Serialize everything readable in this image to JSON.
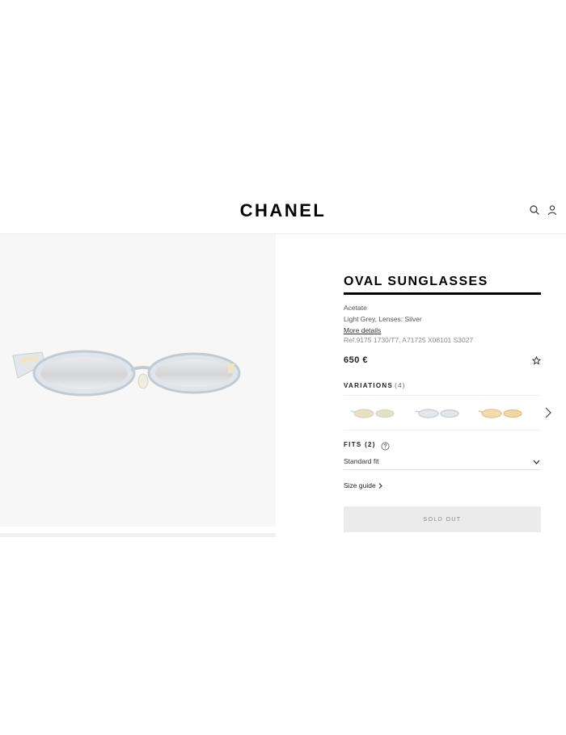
{
  "header": {
    "brand": "CHANEL",
    "icons": [
      "search-icon",
      "account-icon"
    ]
  },
  "product": {
    "title": "OVAL SUNGLASSES",
    "material": "Acetate",
    "color": "Light Grey, Lenses: Silver",
    "more_details": "More details",
    "ref": "Ref.9175 1730/T7, A71725 X08101 S3027",
    "price": "650 €",
    "wishlist_icon": "star-icon"
  },
  "variations": {
    "label": "VARIATIONS",
    "count": "(4)",
    "items": [
      {
        "name": "grey-gold",
        "frame": "#d9d0b0",
        "lens": "#e3dba7"
      },
      {
        "name": "light-grey",
        "frame": "#d6dbe0",
        "lens": "#e6e8ea"
      },
      {
        "name": "amber",
        "frame": "#e8c88e",
        "lens": "#f0d8a8"
      }
    ]
  },
  "fits": {
    "label": "FITS",
    "count": "(2)",
    "selected": "Standard fit"
  },
  "size_guide": "Size guide",
  "cta": "SOLD OUT",
  "colors": {
    "panel": "#f7f7f8",
    "sold_out_bg": "#ebebeb",
    "frame": "#cfd6de",
    "lens": "#dcdde0"
  }
}
